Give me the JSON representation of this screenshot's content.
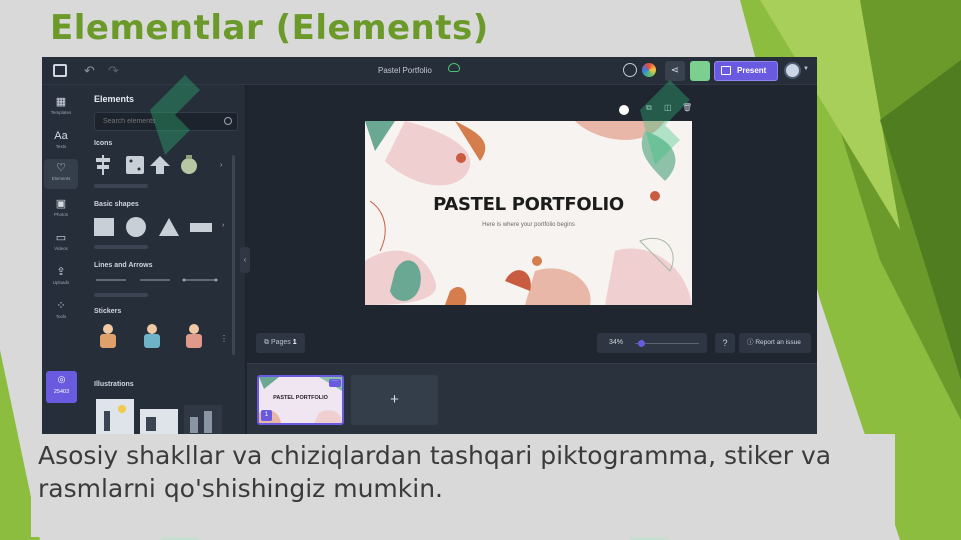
{
  "slide": {
    "title": "Elementlar (Elements)",
    "caption": "Asosiy shakllar va chiziqlardan tashqari piktogramma, stiker va rasmlarni qo'shishingiz mumkin."
  },
  "app": {
    "document_title": "Pastel Portfolio",
    "present_label": "Present",
    "rail": [
      {
        "label": "Templates",
        "icon": "templates-icon"
      },
      {
        "label": "Texts",
        "icon": "text-icon"
      },
      {
        "label": "Elements",
        "icon": "elements-icon"
      },
      {
        "label": "Photos",
        "icon": "photo-icon"
      },
      {
        "label": "Videos",
        "icon": "video-icon"
      },
      {
        "label": "Uploads",
        "icon": "upload-icon"
      },
      {
        "label": "Tools",
        "icon": "tools-icon"
      }
    ],
    "premium_label": "25403",
    "panel": {
      "title": "Elements",
      "search_placeholder": "Search elements",
      "sections": [
        "Icons",
        "Basic shapes",
        "Lines and Arrows",
        "Stickers",
        "Illustrations"
      ]
    },
    "canvas": {
      "heading": "PASTEL PORTFOLIO",
      "subtitle": "Here is where your portfolio begins"
    },
    "pages_label": "Pages",
    "pages_count": "1",
    "zoom": "34%",
    "help_label": "?",
    "report_label": "Report an issue",
    "thumbnail": {
      "title": "PASTEL PORTFOLIO",
      "number": "1"
    },
    "add_page_label": "+"
  },
  "colors": {
    "title_green": "#6b9a2a",
    "editor_bg": "#1f2630",
    "accent_purple": "#6a5ae0"
  }
}
